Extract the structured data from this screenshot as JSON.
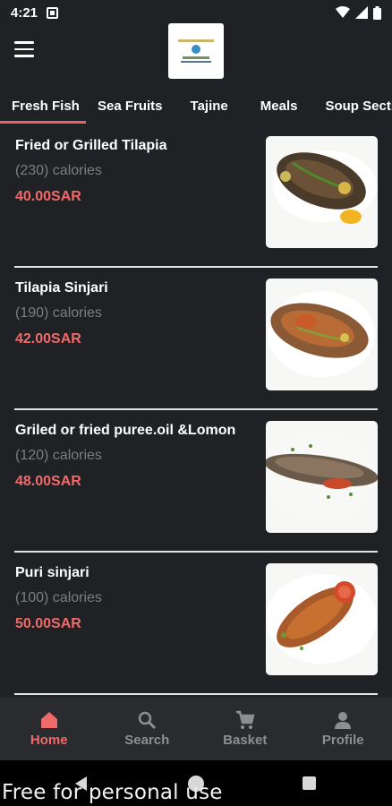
{
  "status_bar": {
    "time": "4:21"
  },
  "tabs": [
    {
      "label": "Fresh Fish"
    },
    {
      "label": "Sea Fruits"
    },
    {
      "label": "Tajine"
    },
    {
      "label": "Meals"
    },
    {
      "label": "Soup Section"
    }
  ],
  "dishes": [
    {
      "name": "Fried or Grilled Tilapia",
      "calories": "(230) calories",
      "price": "40.00SAR"
    },
    {
      "name": "Tilapia Sinjari",
      "calories": "(190) calories",
      "price": "42.00SAR"
    },
    {
      "name": "Griled or fried puree.oil &Lomon",
      "calories": "(120) calories",
      "price": "48.00SAR"
    },
    {
      "name": "Puri sinjari",
      "calories": "(100) calories",
      "price": "50.00SAR"
    }
  ],
  "bottom_nav": [
    {
      "label": "Home",
      "icon": "home-icon"
    },
    {
      "label": "Search",
      "icon": "search-icon"
    },
    {
      "label": "Basket",
      "icon": "cart-icon"
    },
    {
      "label": "Profile",
      "icon": "profile-icon"
    }
  ],
  "colors": {
    "accent": "#ef6a6a",
    "background": "#202125",
    "nav_background": "#2a2b2f"
  },
  "watermark": "Free for personal use"
}
